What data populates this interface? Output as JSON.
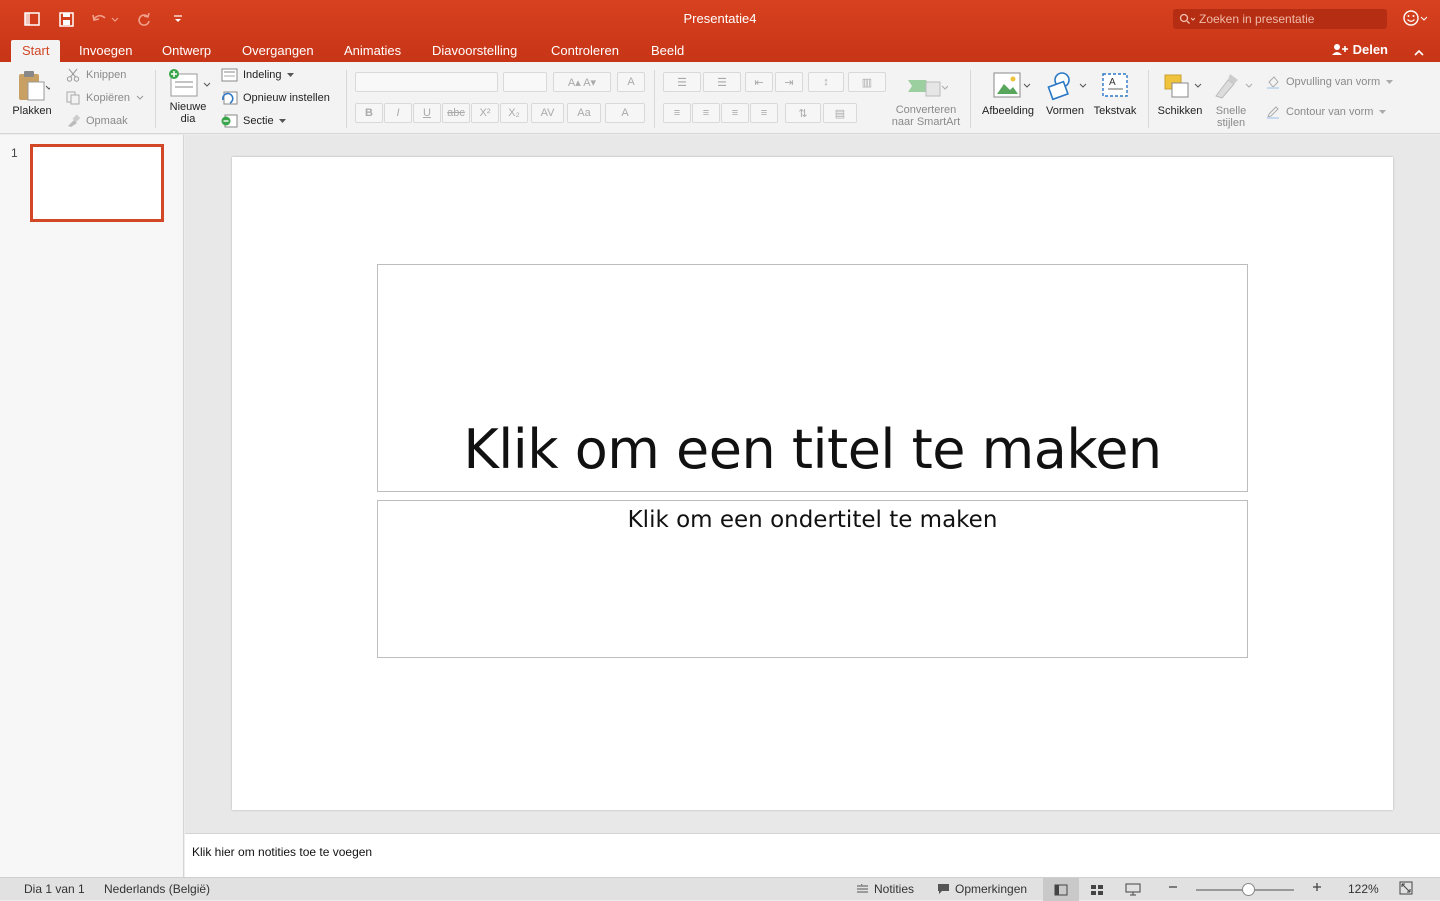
{
  "window": {
    "title": "Presentatie4",
    "search_placeholder": "Zoeken in presentatie"
  },
  "tabs": [
    {
      "label": "Start",
      "active": true
    },
    {
      "label": "Invoegen"
    },
    {
      "label": "Ontwerp"
    },
    {
      "label": "Overgangen"
    },
    {
      "label": "Animaties"
    },
    {
      "label": "Diavoorstelling"
    },
    {
      "label": "Controleren"
    },
    {
      "label": "Beeld"
    }
  ],
  "share_label": "Delen",
  "ribbon": {
    "clipboard": {
      "paste": "Plakken",
      "cut": "Knippen",
      "copy": "Kopiëren",
      "format": "Opmaak"
    },
    "slides": {
      "new_slide_1": "Nieuwe",
      "new_slide_2": "dia",
      "layout": "Indeling",
      "reset": "Opnieuw instellen",
      "section": "Sectie"
    },
    "font": {
      "bold": "B",
      "italic": "I",
      "underline": "U",
      "strike": "abc",
      "superscript": "X²",
      "subscript": "X₂",
      "spacing": "AV",
      "case": "Aa",
      "color": "A"
    },
    "smartart": {
      "line1": "Converteren",
      "line2": "naar SmartArt"
    },
    "insert": {
      "picture": "Afbeelding",
      "shapes": "Vormen",
      "textbox": "Tekstvak"
    },
    "arrange": {
      "arrange": "Schikken",
      "quick_styles_1": "Snelle",
      "quick_styles_2": "stijlen"
    },
    "shape_fill": "Opvulling van vorm",
    "shape_outline": "Contour van vorm"
  },
  "thumbnails": [
    {
      "number": "1"
    }
  ],
  "slide": {
    "title_placeholder": "Klik om een titel te maken",
    "subtitle_placeholder": "Klik om een ondertitel te maken"
  },
  "notes_placeholder": "Klik hier om notities toe te voegen",
  "status": {
    "slide_counter": "Dia 1 van 1",
    "language": "Nederlands (België)",
    "notes": "Notities",
    "comments": "Opmerkingen",
    "zoom": "122%"
  },
  "colors": {
    "accent": "#d24726",
    "titlebar": "#c73517"
  }
}
